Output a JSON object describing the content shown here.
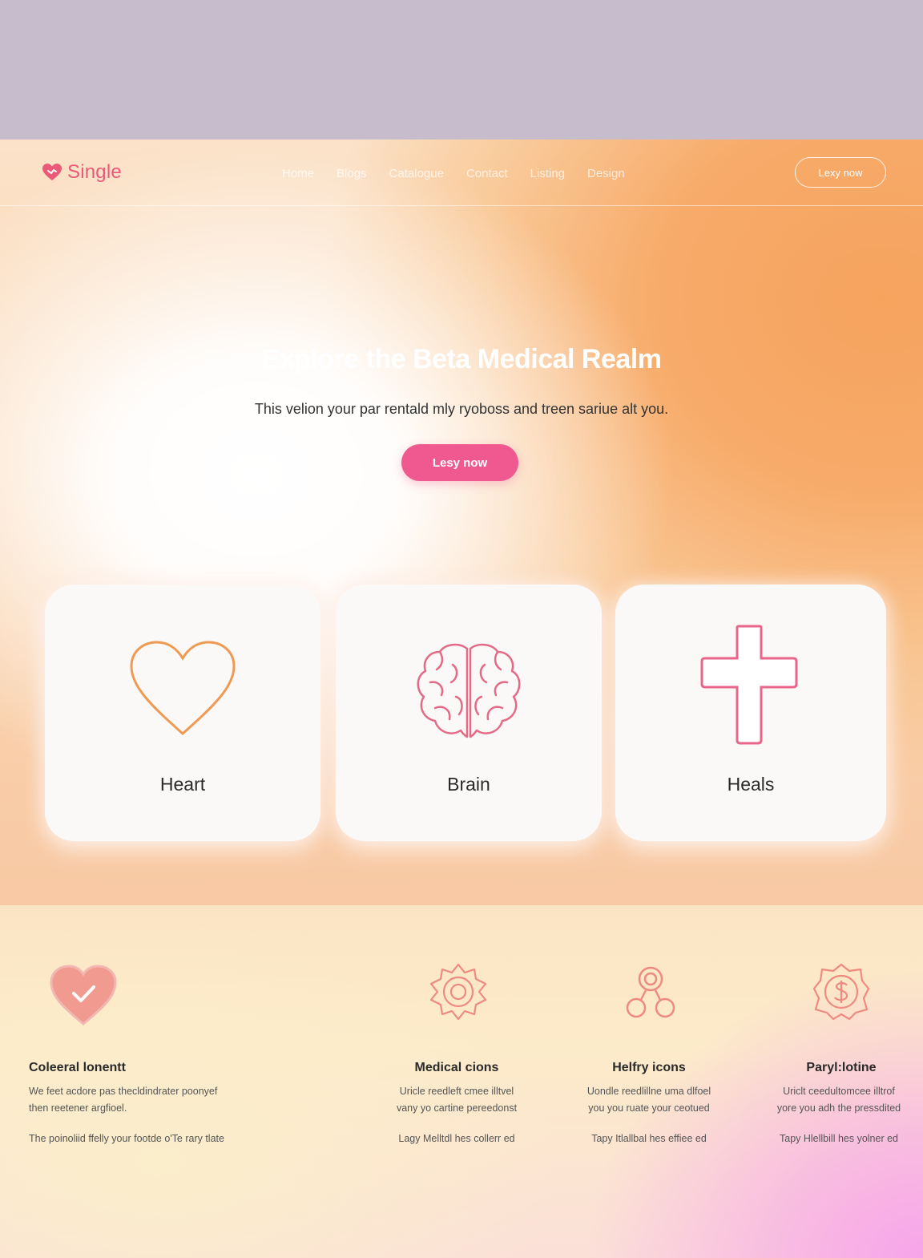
{
  "header": {
    "brand": "Single",
    "nav": [
      "Home",
      "Blogs",
      "Catalogue",
      "Contact",
      "Listing",
      "Design"
    ],
    "cta_label": "Lexy now"
  },
  "hero": {
    "title": "Explore the Beta Medical Realm",
    "subtitle": "This velion your par rentald mly ryoboss and treen sariue alt you.",
    "cta_label": "Lesy now"
  },
  "cards": [
    {
      "label": "Heart",
      "icon": "heart-outline-icon"
    },
    {
      "label": "Brain",
      "icon": "brain-icon"
    },
    {
      "label": "Heals",
      "icon": "medical-cross-icon"
    }
  ],
  "features": [
    {
      "icon": "heart-check-icon",
      "title": "Coleeral lonentt",
      "desc1": "We feet acdore pas thecldindrater poonyef",
      "desc2": "then reetener argfioel.",
      "foot": "The poinoliid ffelly your footde o'Te rary tlate"
    },
    {
      "icon": "gear-badge-icon",
      "title": "Medical cions",
      "desc1": "Uricle reedleft cmee illtvel",
      "desc2": "vany yo cartine pereedonst",
      "foot": "Lagy Melltdl hes collerr ed"
    },
    {
      "icon": "people-icon",
      "title": "Helfry icons",
      "desc1": "Uondle reedlillne uma dlfoel",
      "desc2": "you you ruate your ceotued",
      "foot": "Tapy Itlallbal hes effiee ed"
    },
    {
      "icon": "dollar-badge-icon",
      "title": "Paryl:lotine",
      "desc1": "Uriclt ceedultomcee illtrof",
      "desc2": "yore you adh the pressdited",
      "foot": "Tapy Hlellbill hes yolner ed"
    }
  ],
  "colors": {
    "brand": "#ea5a78",
    "cta": "#f0598f",
    "orange": "#f6a35e",
    "pink": "#f7a4ea"
  }
}
